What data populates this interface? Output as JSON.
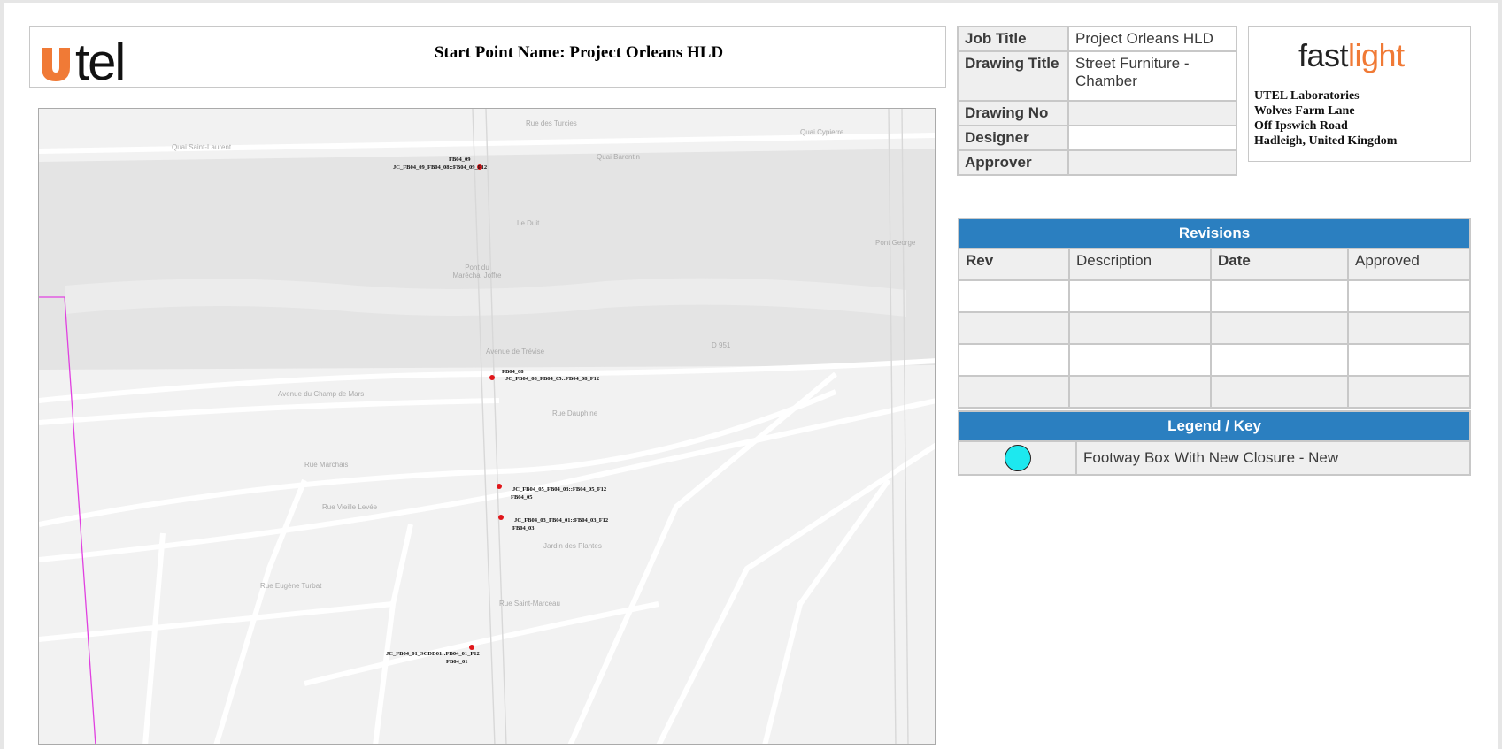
{
  "header": {
    "logo_text": "utel",
    "start_point_label": "Start Point Name: ",
    "start_point_value": "Project Orleans HLD"
  },
  "info": [
    {
      "key": "Job Title",
      "value": "Project Orleans HLD"
    },
    {
      "key": "Drawing Title",
      "value": "Street Furniture - Chamber"
    },
    {
      "key": "Drawing No",
      "value": ""
    },
    {
      "key": "Designer",
      "value": ""
    },
    {
      "key": "Approver",
      "value": ""
    }
  ],
  "company": {
    "logo_dark": "fast",
    "logo_light": "light",
    "address": [
      "UTEL Laboratories",
      "Wolves Farm Lane",
      "Off Ipswich Road",
      "Hadleigh, United Kingdom"
    ]
  },
  "revisions": {
    "title": "Revisions",
    "columns": [
      "Rev",
      "Description",
      "Date",
      "Approved"
    ]
  },
  "legend": {
    "title": "Legend / Key",
    "items": [
      {
        "label": "Footway Box With New Closure - New",
        "color": "#1de8ef"
      }
    ]
  },
  "map": {
    "street_labels": [
      "Quai Saint-Laurent",
      "Rue des Turcies",
      "Quai Barentin",
      "Quai Cypierre",
      "Le Duit",
      "Pont George",
      "Pont du Maréchal Joffre",
      "Avenue de Trévise",
      "Avenue du Champ de Mars",
      "Rue Marchais",
      "Rue Vieille Levée",
      "Rue Dauphine",
      "Jardin des Plantes",
      "Rue Saint-Marceau",
      "Rue Eugène Turbat",
      "D 951"
    ],
    "points": [
      {
        "id": "FB04_09",
        "label": "JC_FB04_09_FB04_08::FB04_09_F12"
      },
      {
        "id": "FB04_08",
        "label": "JC_FB04_08_FB04_05::FB04_08_F12"
      },
      {
        "id": "FB04_05",
        "label": "JC_FB04_05_FB04_03::FB04_05_F12"
      },
      {
        "id": "FB04_03",
        "label": "JC_FB04_03_FB04_01::FB04_03_F12"
      },
      {
        "id": "FB04_01",
        "label": "JC_FB04_01_SCDD01::FB04_01_F12"
      }
    ]
  },
  "colors": {
    "accent": "#2b7fc0",
    "brand_orange": "#f07a36",
    "point": "#e0161a",
    "boundary": "#e040e0"
  }
}
